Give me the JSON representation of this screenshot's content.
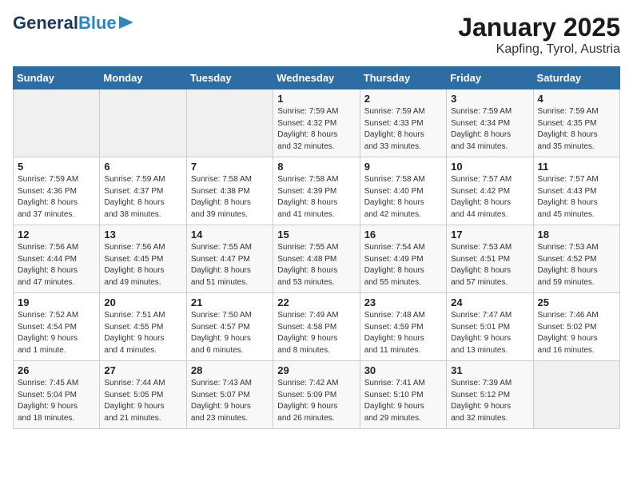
{
  "header": {
    "logo_general": "General",
    "logo_blue": "Blue",
    "month_year": "January 2025",
    "location": "Kapfing, Tyrol, Austria"
  },
  "days_of_week": [
    "Sunday",
    "Monday",
    "Tuesday",
    "Wednesday",
    "Thursday",
    "Friday",
    "Saturday"
  ],
  "weeks": [
    [
      {
        "day": "",
        "content": ""
      },
      {
        "day": "",
        "content": ""
      },
      {
        "day": "",
        "content": ""
      },
      {
        "day": "1",
        "content": "Sunrise: 7:59 AM\nSunset: 4:32 PM\nDaylight: 8 hours\nand 32 minutes."
      },
      {
        "day": "2",
        "content": "Sunrise: 7:59 AM\nSunset: 4:33 PM\nDaylight: 8 hours\nand 33 minutes."
      },
      {
        "day": "3",
        "content": "Sunrise: 7:59 AM\nSunset: 4:34 PM\nDaylight: 8 hours\nand 34 minutes."
      },
      {
        "day": "4",
        "content": "Sunrise: 7:59 AM\nSunset: 4:35 PM\nDaylight: 8 hours\nand 35 minutes."
      }
    ],
    [
      {
        "day": "5",
        "content": "Sunrise: 7:59 AM\nSunset: 4:36 PM\nDaylight: 8 hours\nand 37 minutes."
      },
      {
        "day": "6",
        "content": "Sunrise: 7:59 AM\nSunset: 4:37 PM\nDaylight: 8 hours\nand 38 minutes."
      },
      {
        "day": "7",
        "content": "Sunrise: 7:58 AM\nSunset: 4:38 PM\nDaylight: 8 hours\nand 39 minutes."
      },
      {
        "day": "8",
        "content": "Sunrise: 7:58 AM\nSunset: 4:39 PM\nDaylight: 8 hours\nand 41 minutes."
      },
      {
        "day": "9",
        "content": "Sunrise: 7:58 AM\nSunset: 4:40 PM\nDaylight: 8 hours\nand 42 minutes."
      },
      {
        "day": "10",
        "content": "Sunrise: 7:57 AM\nSunset: 4:42 PM\nDaylight: 8 hours\nand 44 minutes."
      },
      {
        "day": "11",
        "content": "Sunrise: 7:57 AM\nSunset: 4:43 PM\nDaylight: 8 hours\nand 45 minutes."
      }
    ],
    [
      {
        "day": "12",
        "content": "Sunrise: 7:56 AM\nSunset: 4:44 PM\nDaylight: 8 hours\nand 47 minutes."
      },
      {
        "day": "13",
        "content": "Sunrise: 7:56 AM\nSunset: 4:45 PM\nDaylight: 8 hours\nand 49 minutes."
      },
      {
        "day": "14",
        "content": "Sunrise: 7:55 AM\nSunset: 4:47 PM\nDaylight: 8 hours\nand 51 minutes."
      },
      {
        "day": "15",
        "content": "Sunrise: 7:55 AM\nSunset: 4:48 PM\nDaylight: 8 hours\nand 53 minutes."
      },
      {
        "day": "16",
        "content": "Sunrise: 7:54 AM\nSunset: 4:49 PM\nDaylight: 8 hours\nand 55 minutes."
      },
      {
        "day": "17",
        "content": "Sunrise: 7:53 AM\nSunset: 4:51 PM\nDaylight: 8 hours\nand 57 minutes."
      },
      {
        "day": "18",
        "content": "Sunrise: 7:53 AM\nSunset: 4:52 PM\nDaylight: 8 hours\nand 59 minutes."
      }
    ],
    [
      {
        "day": "19",
        "content": "Sunrise: 7:52 AM\nSunset: 4:54 PM\nDaylight: 9 hours\nand 1 minute."
      },
      {
        "day": "20",
        "content": "Sunrise: 7:51 AM\nSunset: 4:55 PM\nDaylight: 9 hours\nand 4 minutes."
      },
      {
        "day": "21",
        "content": "Sunrise: 7:50 AM\nSunset: 4:57 PM\nDaylight: 9 hours\nand 6 minutes."
      },
      {
        "day": "22",
        "content": "Sunrise: 7:49 AM\nSunset: 4:58 PM\nDaylight: 9 hours\nand 8 minutes."
      },
      {
        "day": "23",
        "content": "Sunrise: 7:48 AM\nSunset: 4:59 PM\nDaylight: 9 hours\nand 11 minutes."
      },
      {
        "day": "24",
        "content": "Sunrise: 7:47 AM\nSunset: 5:01 PM\nDaylight: 9 hours\nand 13 minutes."
      },
      {
        "day": "25",
        "content": "Sunrise: 7:46 AM\nSunset: 5:02 PM\nDaylight: 9 hours\nand 16 minutes."
      }
    ],
    [
      {
        "day": "26",
        "content": "Sunrise: 7:45 AM\nSunset: 5:04 PM\nDaylight: 9 hours\nand 18 minutes."
      },
      {
        "day": "27",
        "content": "Sunrise: 7:44 AM\nSunset: 5:05 PM\nDaylight: 9 hours\nand 21 minutes."
      },
      {
        "day": "28",
        "content": "Sunrise: 7:43 AM\nSunset: 5:07 PM\nDaylight: 9 hours\nand 23 minutes."
      },
      {
        "day": "29",
        "content": "Sunrise: 7:42 AM\nSunset: 5:09 PM\nDaylight: 9 hours\nand 26 minutes."
      },
      {
        "day": "30",
        "content": "Sunrise: 7:41 AM\nSunset: 5:10 PM\nDaylight: 9 hours\nand 29 minutes."
      },
      {
        "day": "31",
        "content": "Sunrise: 7:39 AM\nSunset: 5:12 PM\nDaylight: 9 hours\nand 32 minutes."
      },
      {
        "day": "",
        "content": ""
      }
    ]
  ]
}
